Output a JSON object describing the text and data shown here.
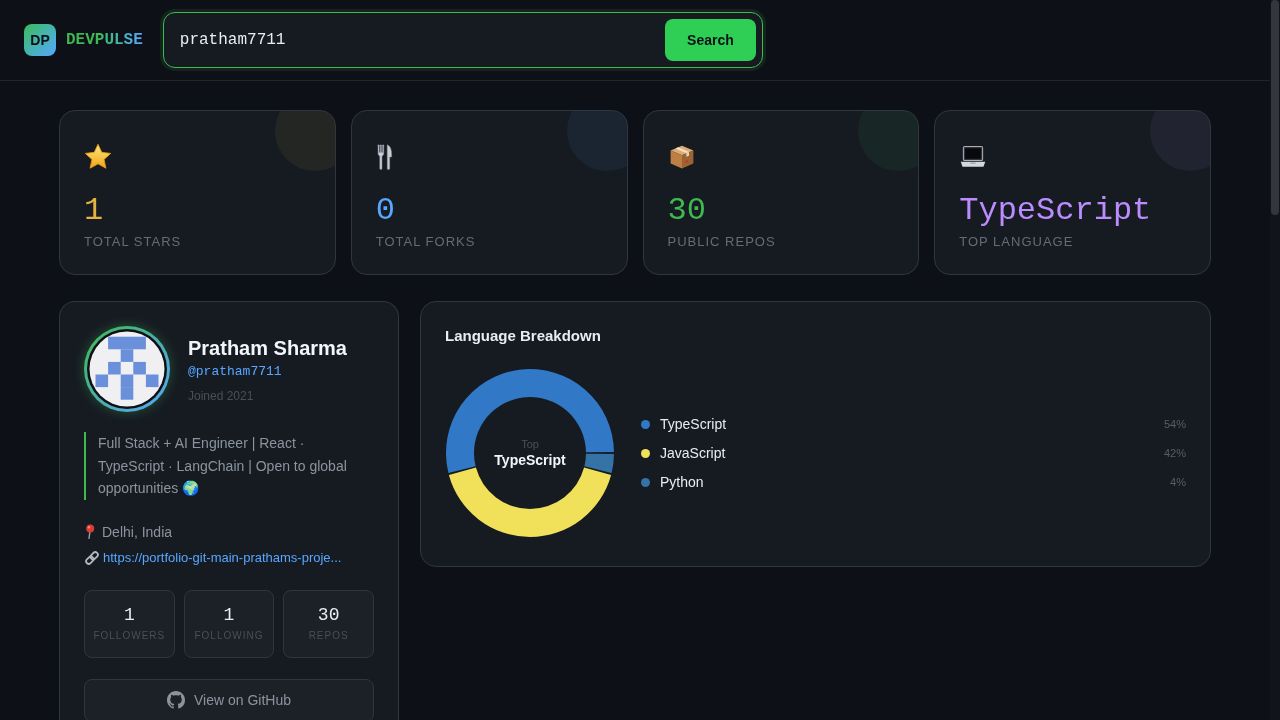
{
  "header": {
    "logo": {
      "badge": "DP",
      "name": "DEVPULSE"
    },
    "search": {
      "value": "pratham7711",
      "button": "Search"
    }
  },
  "stats": [
    {
      "kind": "stars",
      "value": "1",
      "label": "TOTAL STARS",
      "color": "#e3b341"
    },
    {
      "kind": "forks",
      "value": "0",
      "label": "TOTAL FORKS",
      "color": "#58a6ff"
    },
    {
      "kind": "repos",
      "value": "30",
      "label": "PUBLIC REPOS",
      "color": "#3fb950"
    },
    {
      "kind": "language",
      "value": "TypeScript",
      "label": "TOP LANGUAGE",
      "color": "#bc8cff"
    }
  ],
  "profile": {
    "name": "Pratham Sharma",
    "handle": "@pratham7711",
    "joined": "Joined 2021",
    "bio": "Full Stack + AI Engineer | React · TypeScript · LangChain | Open to global opportunities 🌍",
    "location": "Delhi, India",
    "website": "https://portfolio-git-main-prathams-proje...",
    "counts": [
      {
        "value": "1",
        "label": "FOLLOWERS"
      },
      {
        "value": "1",
        "label": "FOLLOWING"
      },
      {
        "value": "30",
        "label": "REPOS"
      }
    ],
    "button": "View on GitHub"
  },
  "language_breakdown": {
    "title": "Language Breakdown",
    "center_caption": "Top",
    "center_value": "TypeScript",
    "chart_data": {
      "type": "donut",
      "categories": [
        "TypeScript",
        "JavaScript",
        "Python"
      ],
      "values": [
        54,
        42,
        4
      ],
      "legend": "right"
    },
    "legend_entries": [
      {
        "color": "#3178c6",
        "percent": "54%"
      },
      {
        "color": "#f1e05a",
        "percent": "42%"
      },
      {
        "color": "#3572a5",
        "percent": "4%"
      }
    ]
  }
}
